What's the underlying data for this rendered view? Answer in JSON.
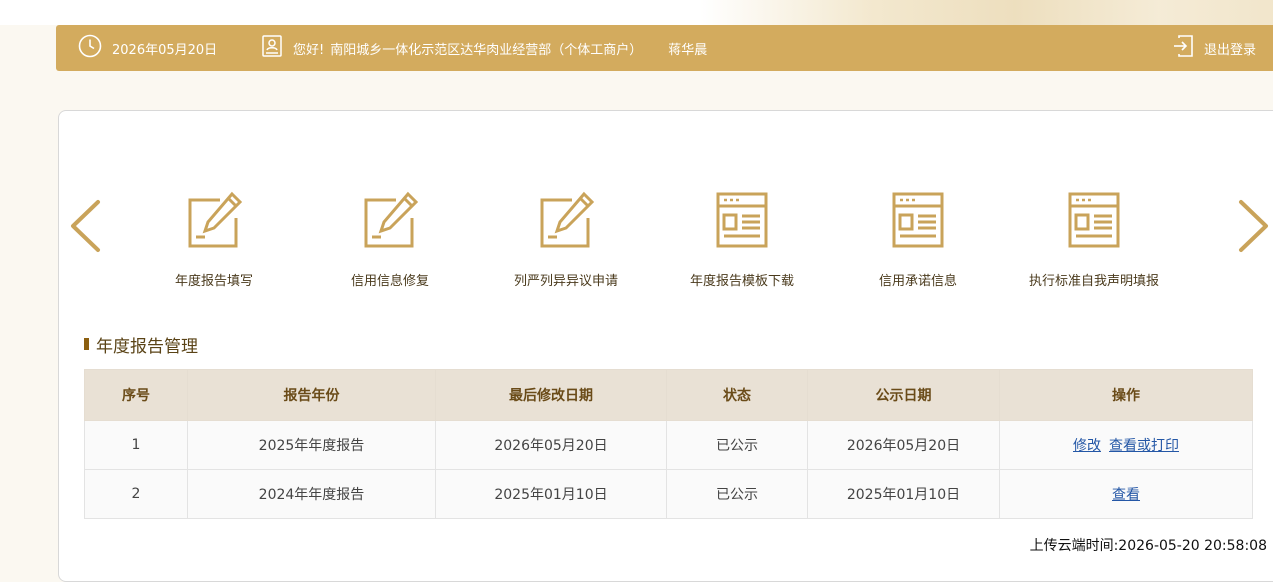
{
  "header": {
    "date": "2026年05月20日",
    "greeting": "您好!",
    "company": "南阳城乡一体化示范区达华肉业经营部（个体工商户）",
    "user_name": "蒋华晨",
    "logout_label": "退出登录",
    "bg_color": "#d3ab5e"
  },
  "quick_menu": [
    {
      "label": "年度报告填写",
      "icon": "edit-icon"
    },
    {
      "label": "信用信息修复",
      "icon": "edit-icon"
    },
    {
      "label": "列严列异异议申请",
      "icon": "edit-icon"
    },
    {
      "label": "年度报告模板下载",
      "icon": "document-icon"
    },
    {
      "label": "信用承诺信息",
      "icon": "document-icon"
    },
    {
      "label": "执行标准自我声明填报",
      "icon": "document-icon"
    }
  ],
  "section": {
    "title": "年度报告管理"
  },
  "table": {
    "columns": [
      "序号",
      "报告年份",
      "最后修改日期",
      "状态",
      "公示日期",
      "操作"
    ],
    "rows": [
      {
        "no": "1",
        "year": "2025年年度报告",
        "modified": "2026年05月20日",
        "status": "已公示",
        "publish": "2026年05月20日",
        "actions": [
          "修改",
          "查看或打印"
        ]
      },
      {
        "no": "2",
        "year": "2024年年度报告",
        "modified": "2025年01月10日",
        "status": "已公示",
        "publish": "2025年01月10日",
        "actions": [
          "查看"
        ]
      }
    ]
  },
  "footer": {
    "upload_time": "上传云端时间:2026-05-20 20:58:08"
  },
  "colors": {
    "accent": "#d3ab5e",
    "icon": "#c9a35a",
    "link": "#2457a6"
  }
}
